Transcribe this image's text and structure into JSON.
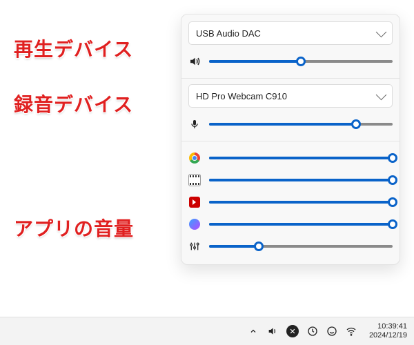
{
  "labels": {
    "playback": "再生デバイス",
    "recording": "録音デバイス",
    "app_volume": "アプリの音量"
  },
  "playback": {
    "device": "USB Audio DAC",
    "volume": 50
  },
  "recording": {
    "device": "HD Pro Webcam C910",
    "volume": 80
  },
  "apps": [
    {
      "icon": "chrome",
      "name": "Google Chrome",
      "volume": 100
    },
    {
      "icon": "mpc",
      "name": "Media Player Classic",
      "volume": 100
    },
    {
      "icon": "yt",
      "name": "YouTube",
      "volume": 100
    },
    {
      "icon": "wf",
      "name": "Waterfox",
      "volume": 100
    }
  ],
  "mixer": {
    "volume": 27
  },
  "taskbar": {
    "time": "10:39:41",
    "date": "2024/12/19"
  }
}
